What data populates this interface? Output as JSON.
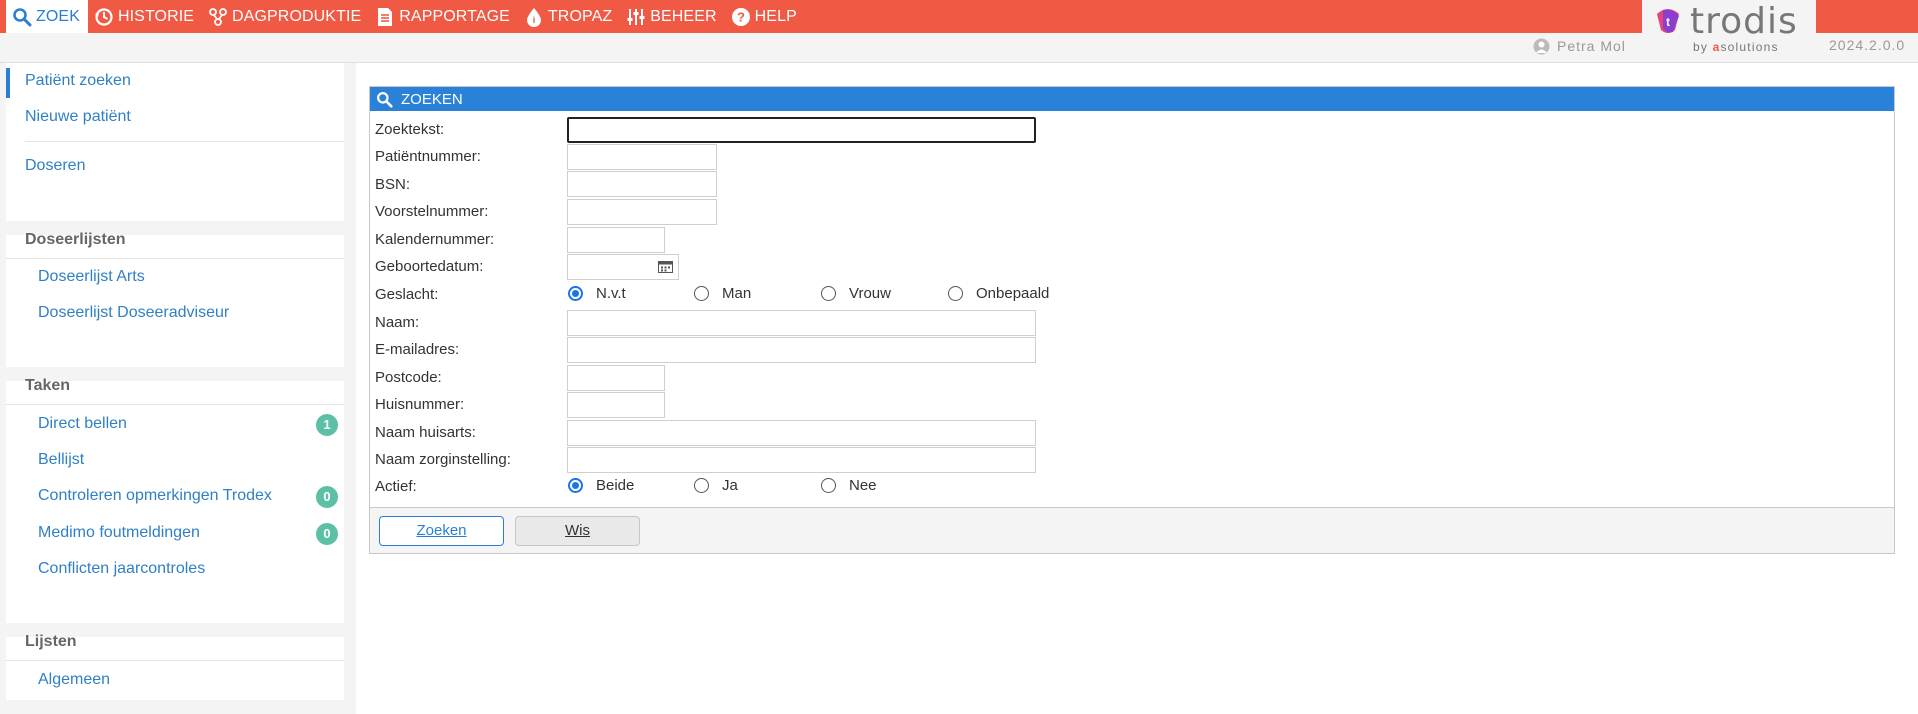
{
  "nav": {
    "items": [
      {
        "label": "ZOEK",
        "icon": "search-icon"
      },
      {
        "label": "HISTORIE",
        "icon": "history-icon"
      },
      {
        "label": "DAGPRODUKTIE",
        "icon": "network-icon"
      },
      {
        "label": "RAPPORTAGE",
        "icon": "document-icon"
      },
      {
        "label": "TROPAZ",
        "icon": "drop-icon"
      },
      {
        "label": "BEHEER",
        "icon": "sliders-icon"
      },
      {
        "label": "HELP",
        "icon": "help-icon"
      }
    ],
    "active_color": "#2a7fd4",
    "bar_color": "#f05a44"
  },
  "brand": {
    "name": "trodis",
    "by_prefix": "by ",
    "by_accent": "a",
    "by_suffix": "solutions"
  },
  "user": {
    "name": "Petra Mol",
    "icon": "user-icon"
  },
  "version": "2024.2.0.0",
  "sidebar": {
    "top_links": [
      "Patiënt zoeken",
      "Nieuwe patiënt",
      "Doseren"
    ],
    "sections": [
      {
        "title": "Doseerlijsten",
        "items": [
          {
            "label": "Doseerlijst Arts"
          },
          {
            "label": "Doseerlijst Doseeradviseur"
          }
        ]
      },
      {
        "title": "Taken",
        "items": [
          {
            "label": "Direct bellen",
            "badge": "1"
          },
          {
            "label": "Bellijst"
          },
          {
            "label": "Controleren opmerkingen Trodex",
            "badge": "0"
          },
          {
            "label": "Medimo foutmeldingen",
            "badge": "0"
          },
          {
            "label": "Conflicten jaarcontroles"
          }
        ]
      },
      {
        "title": "Lijsten",
        "items": [
          {
            "label": "Algemeen"
          }
        ]
      }
    ]
  },
  "panel": {
    "title": "ZOEKEN",
    "labels": {
      "zoektekst": "Zoektekst:",
      "patientnummer": "Patiëntnummer:",
      "bsn": "BSN:",
      "voorstelnummer": "Voorstelnummer:",
      "kalendernummer": "Kalendernummer:",
      "geboortedatum": "Geboortedatum:",
      "geslacht": "Geslacht:",
      "naam": "Naam:",
      "email": "E-mailadres:",
      "postcode": "Postcode:",
      "huisnummer": "Huisnummer:",
      "naam_huisarts": "Naam huisarts:",
      "naam_zorginstelling": "Naam zorginstelling:",
      "actief": "Actief:"
    },
    "values": {
      "zoektekst": "",
      "patientnummer": "",
      "bsn": "",
      "voorstelnummer": "",
      "kalendernummer": "",
      "geboortedatum": "",
      "naam": "",
      "email": "",
      "postcode": "",
      "huisnummer": "",
      "naam_huisarts": "",
      "naam_zorginstelling": ""
    },
    "geslacht_options": [
      "N.v.t",
      "Man",
      "Vrouw",
      "Onbepaald"
    ],
    "geslacht_selected": "N.v.t",
    "actief_options": [
      "Beide",
      "Ja",
      "Nee"
    ],
    "actief_selected": "Beide",
    "buttons": {
      "search": "Zoeken",
      "clear": "Wis"
    }
  }
}
